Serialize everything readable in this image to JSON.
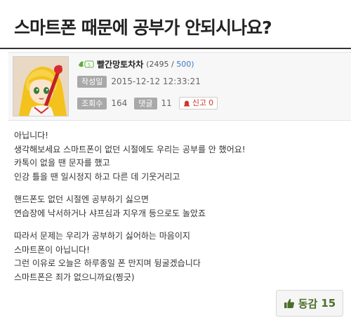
{
  "post": {
    "title": "스마트폰 때문에 공부가 안되시나요?",
    "author": {
      "nickname": "빨간망토차차",
      "points": "(2495",
      "separator": "/",
      "max_points": "500)"
    },
    "date_label": "작성일",
    "date": "2015-12-12 12:33:21",
    "views_label": "조회수",
    "views": "164",
    "comments_label": "댓글",
    "comments": "11",
    "report_label": "신고",
    "report_count": "0",
    "body": [
      [
        "아닙니다!",
        "생각해보세요 스마트폰이 없던 시절에도 우리는 공부를 안 했어요!",
        "카톡이 없을 땐 문자를 했고",
        "인강 틀을 땐 일시정지 하고 다른 데 기웃거리고"
      ],
      [
        "핸드폰도 없던 시절엔 공부하기 싫으면",
        "연습장에 낙서하거나 샤프심과 지우개 등으로도 놀았죠"
      ],
      [
        "따라서 문제는 우리가 공부하기 싫어하는 마음이지",
        "스마트폰이 아닙니다!",
        "그런 이유로 오늘은 하루종일 폰 만지며 뒹굴겠습니다",
        "스마트폰은 죄가 없으니까요(찡긋)"
      ]
    ],
    "like_label": "동감",
    "like_count": "15"
  },
  "colors": {
    "accent_blue": "#3a78c8",
    "report_red": "#d0342c",
    "like_green": "#4a6f2c"
  }
}
